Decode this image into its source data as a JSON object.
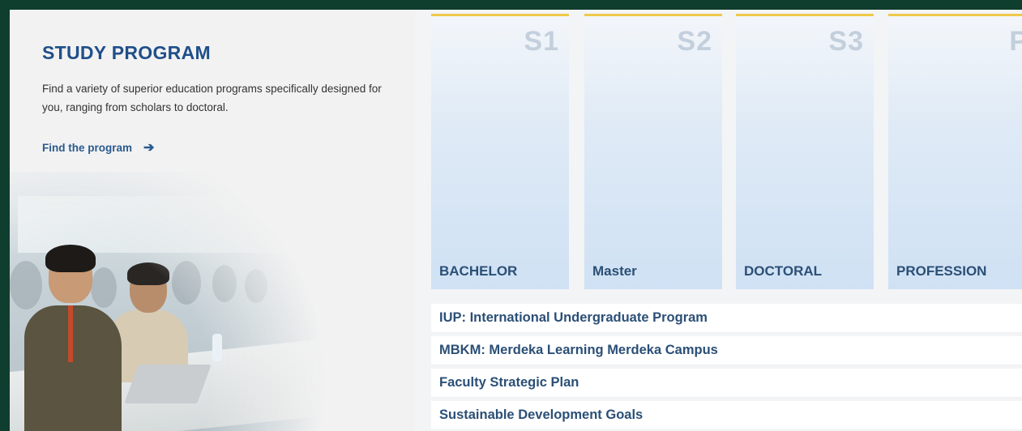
{
  "study_program": {
    "title": "STUDY PROGRAM",
    "description": "Find a variety of superior education programs specifically designed for you, ranging from scholars to doctoral.",
    "find_link": "Find the program",
    "arrow_icon": "arrow-right-icon"
  },
  "cards": [
    {
      "code": "S1",
      "name": "BACHELOR"
    },
    {
      "code": "S2",
      "name": "Master"
    },
    {
      "code": "S3",
      "name": "DOCTORAL"
    },
    {
      "code": "P",
      "name": "PROFESSION"
    }
  ],
  "links": [
    "IUP: International Undergraduate Program",
    "MBKM: Merdeka Learning Merdeka Campus",
    "Faculty Strategic Plan",
    "Sustainable Development Goals"
  ],
  "colors": {
    "frame": "#0f3d2e",
    "title": "#1f4f8a",
    "card_accent": "#f0c94a",
    "card_text": "#2b4f76"
  }
}
